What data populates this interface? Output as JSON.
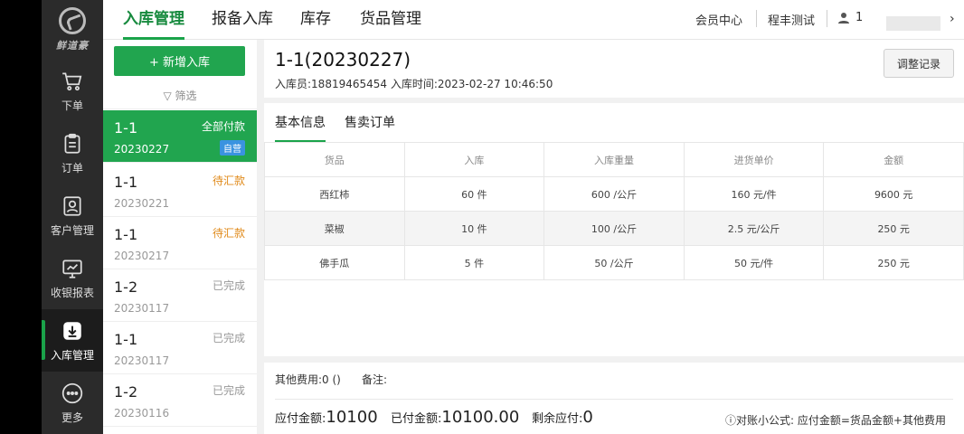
{
  "brand": "鲜道豪",
  "nav": {
    "items": [
      {
        "label": "下单",
        "icon": "cart-icon"
      },
      {
        "label": "订单",
        "icon": "clipboard-icon"
      },
      {
        "label": "客户管理",
        "icon": "contact-card-icon"
      },
      {
        "label": "收银报表",
        "icon": "chart-monitor-icon"
      },
      {
        "label": "入库管理",
        "icon": "download-box-icon"
      },
      {
        "label": "更多",
        "icon": "more-dots-icon"
      }
    ]
  },
  "header": {
    "tabs": [
      "入库管理",
      "报备入库",
      "库存",
      "货品管理"
    ],
    "member_center": "会员中心",
    "test_user": "程丰测试",
    "user_name": "1"
  },
  "list": {
    "add_button": "+ 新增入库",
    "filter": "筛选",
    "rows": [
      {
        "code": "1-1",
        "date": "20230227",
        "status": "全部付款",
        "badge": "自营"
      },
      {
        "code": "1-1",
        "date": "20230221",
        "status": "待汇款"
      },
      {
        "code": "1-1",
        "date": "20230217",
        "status": "待汇款"
      },
      {
        "code": "1-2",
        "date": "20230117",
        "status": "已完成"
      },
      {
        "code": "1-1",
        "date": "20230117",
        "status": "已完成"
      },
      {
        "code": "1-2",
        "date": "20230116",
        "status": "已完成"
      }
    ]
  },
  "detail": {
    "title": "1-1(20230227)",
    "meta": "入库员:18819465454  入库时间:2023-02-27 10:46:50",
    "adjust_button": "调整记录",
    "tabs": [
      "基本信息",
      "售卖订单"
    ],
    "table": {
      "headers": [
        "货品",
        "入库",
        "入库重量",
        "进货单价",
        "金额"
      ],
      "rows": [
        [
          "西红柿",
          "60 件",
          "600 /公斤",
          "160 元/件",
          "9600 元"
        ],
        [
          "菜椒",
          "10 件",
          "100 /公斤",
          "2.5 元/公斤",
          "250 元"
        ],
        [
          "佛手瓜",
          "5 件",
          "50 /公斤",
          "50 元/件",
          "250 元"
        ]
      ]
    },
    "footer": {
      "other_fee": "其他费用:0 ()",
      "remark": "备注:",
      "payable_label": "应付金额:",
      "payable_value": "10100",
      "paid_label": "已付金额:",
      "paid_value": "10100.00",
      "remaining_label": "剩余应付:",
      "remaining_value": "0",
      "formula": "ⓘ对账小公式: 应付金额=货品金额+其他费用"
    }
  },
  "colors": {
    "accent": "#21a54f",
    "pending": "#e08a1a",
    "badge": "#3a93e0",
    "nav_bg": "#2b2b2b"
  }
}
